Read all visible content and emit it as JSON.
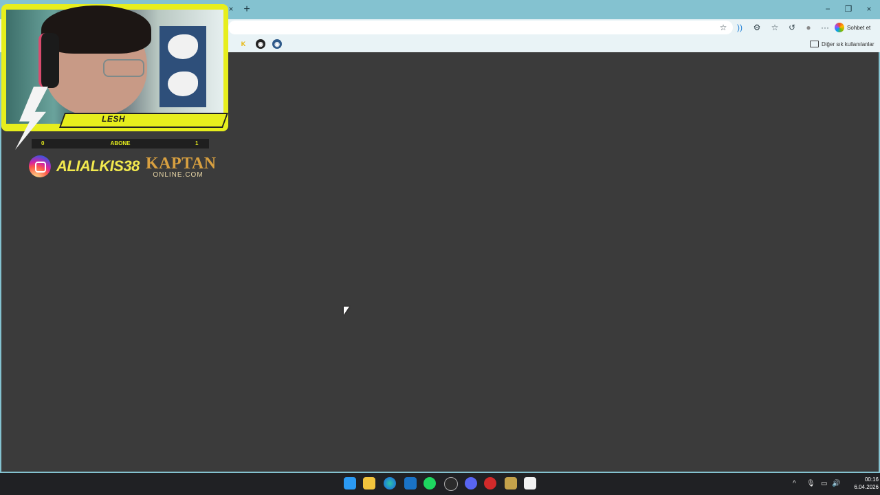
{
  "browser": {
    "chat_button_label": "Sohbet et",
    "other_bookmarks_label": "Diğer sık kullanılanlar",
    "new_tab_glyph": "+",
    "tab_close_glyph": "×",
    "window_controls": {
      "minimize": "−",
      "maximize": "❐",
      "close": "×"
    },
    "toolbar_icons": {
      "favorite": "☆",
      "read_aloud": "))",
      "extensions": "⚙",
      "favorites_list": "☆",
      "history": "↺",
      "profile": "●",
      "more": "···"
    },
    "bookmarks": [
      {
        "glyph": "K",
        "icon": "kaptan-favicon"
      },
      {
        "glyph": "◉",
        "icon": "site-favicon"
      },
      {
        "glyph": "◉",
        "icon": "site-favicon-blue"
      }
    ]
  },
  "overlay": {
    "streamer_name": "LESH",
    "subscriber_goal": {
      "current": "0",
      "label": "ABONE",
      "target": "1"
    },
    "instagram_handle": "ALIALKIS38",
    "sponsor": {
      "name_top": "KAPTAN",
      "name_bottom": "ONLINE.COM"
    }
  },
  "taskbar": {
    "apps": [
      "start",
      "file-explorer",
      "edge",
      "outlook",
      "spotify",
      "steam",
      "discord",
      "app",
      "league-of-legends",
      "store"
    ],
    "tray": {
      "chevron": "^",
      "mic": "🎙",
      "network": "▭",
      "volume": "🔊"
    },
    "clock_time": "00:16",
    "clock_date": "6.04.2026"
  },
  "colors": {
    "chrome": "#84c2d0",
    "overlay_accent": "#e7ee1d",
    "page_background": "#3b3b3b",
    "taskbar": "#202124"
  }
}
